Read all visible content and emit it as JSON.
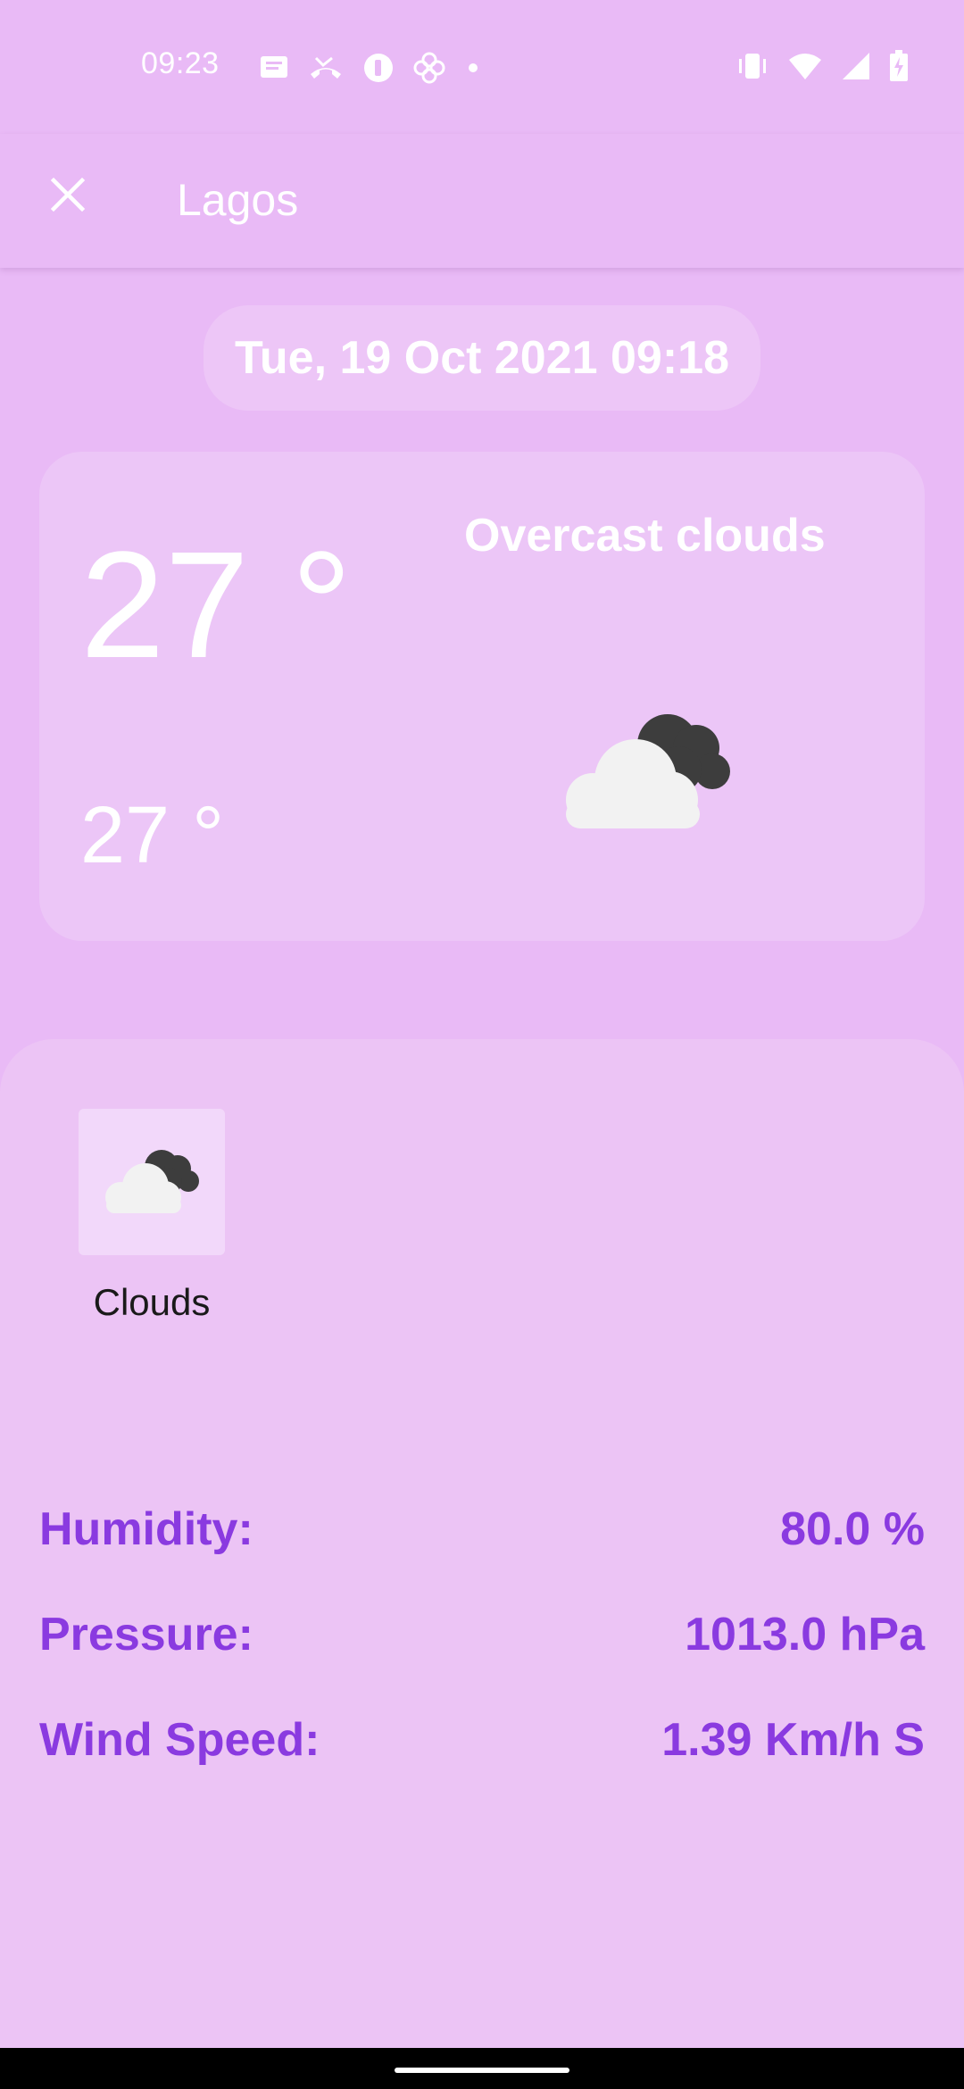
{
  "status_bar": {
    "time": "09:23",
    "icons_left": [
      "message-icon",
      "missed-call-icon",
      "app-notification-icon",
      "pinwheel-icon",
      "more-dot-icon"
    ],
    "icons_right": [
      "vibrate-icon",
      "wifi-icon",
      "signal-icon",
      "battery-charging-icon"
    ]
  },
  "app_bar": {
    "close_icon": "close-icon",
    "title": "Lagos"
  },
  "date": "Tue, 19 Oct 2021 09:18",
  "current": {
    "temperature": "27 °",
    "feels_like": "27 °",
    "condition": "Overcast clouds",
    "icon": "overcast-clouds-icon"
  },
  "conditions": {
    "label": "Clouds",
    "icon": "clouds-icon"
  },
  "stats": {
    "humidity": {
      "label": "Humidity:",
      "value": "80.0 %"
    },
    "pressure": {
      "label": "Pressure:",
      "value": "1013.0 hPa"
    },
    "wind": {
      "label": "Wind Speed:",
      "value": "1.39 Km/h S"
    }
  },
  "colors": {
    "background": "#E9BAF6",
    "card": "#ECC6F7",
    "accent_text": "#8A3AE0"
  }
}
